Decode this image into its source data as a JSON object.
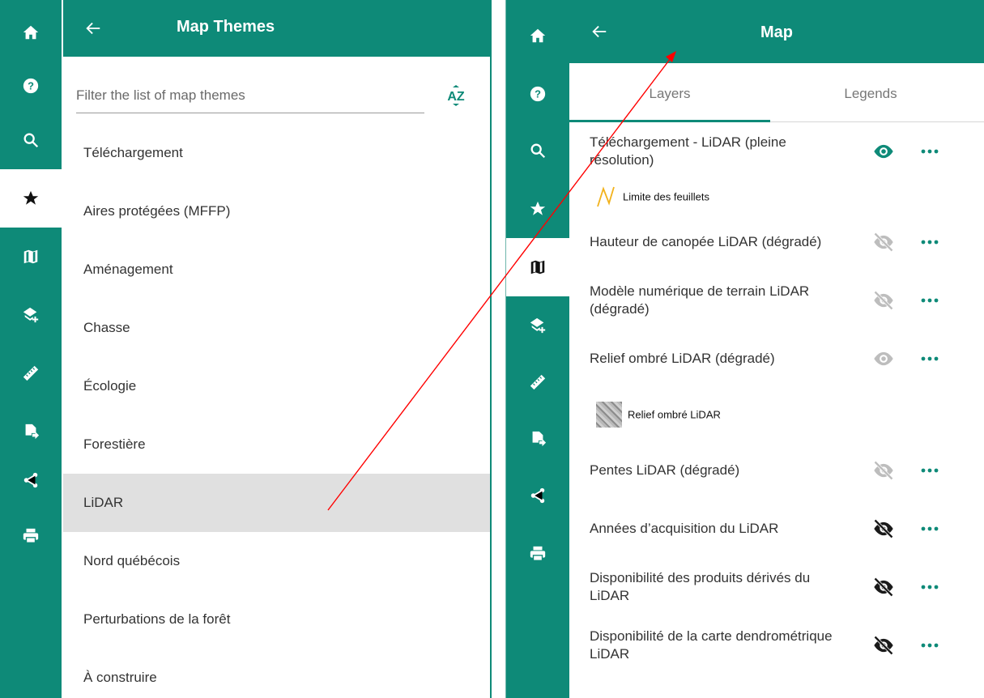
{
  "left_panel": {
    "header": {
      "title": "Map Themes"
    },
    "filter": {
      "placeholder": "Filter the list of map themes",
      "sort_label": "AZ"
    },
    "themes": [
      {
        "label": "Téléchargement"
      },
      {
        "label": "Aires protégées (MFFP)"
      },
      {
        "label": "Aménagement"
      },
      {
        "label": "Chasse"
      },
      {
        "label": "Écologie"
      },
      {
        "label": "Forestière"
      },
      {
        "label": "LiDAR"
      },
      {
        "label": "Nord québécois"
      },
      {
        "label": "Perturbations de la forêt"
      },
      {
        "label": "À construire"
      }
    ],
    "selected_theme": "LiDAR"
  },
  "rail": {
    "items": [
      "home-icon",
      "help-icon",
      "search-icon",
      "star-icon",
      "map-icon",
      "add-layer-icon",
      "ruler-icon",
      "export-icon",
      "share-icon",
      "print-icon"
    ],
    "left_active": "star-icon",
    "right_active": "map-icon"
  },
  "right_panel": {
    "header": {
      "title": "Map"
    },
    "tabs": [
      {
        "label": "Layers"
      },
      {
        "label": "Legends"
      }
    ],
    "active_tab": "Layers",
    "layers": [
      {
        "name": "Téléchargement - LiDAR (pleine résolution)",
        "visibility": "visible-accent",
        "legend": {
          "label": "Limite des feuillets",
          "symbol": "line-icon"
        }
      },
      {
        "name": "Hauteur de canopée LiDAR (dégradé)",
        "visibility": "hidden-grey"
      },
      {
        "name": "Modèle numérique de terrain LiDAR (dégradé)",
        "visibility": "hidden-grey"
      },
      {
        "name": "Relief ombré LiDAR (dégradé)",
        "visibility": "visible-grey",
        "legend": {
          "label": "Relief ombré LiDAR",
          "symbol": "hillshade-image"
        }
      },
      {
        "name": "Pentes LiDAR (dégradé)",
        "visibility": "hidden-grey"
      },
      {
        "name": "Années d’acquisition du LiDAR",
        "visibility": "hidden-dark"
      },
      {
        "name": "Disponibilité des produits dérivés du LiDAR",
        "visibility": "hidden-dark"
      },
      {
        "name": "Disponibilité de la carte dendrométrique LiDAR",
        "visibility": "hidden-dark"
      }
    ]
  },
  "colors": {
    "accent": "#0e8a78",
    "selected_row": "#e0e0e0",
    "annotation_arrow": "#ff0000"
  }
}
